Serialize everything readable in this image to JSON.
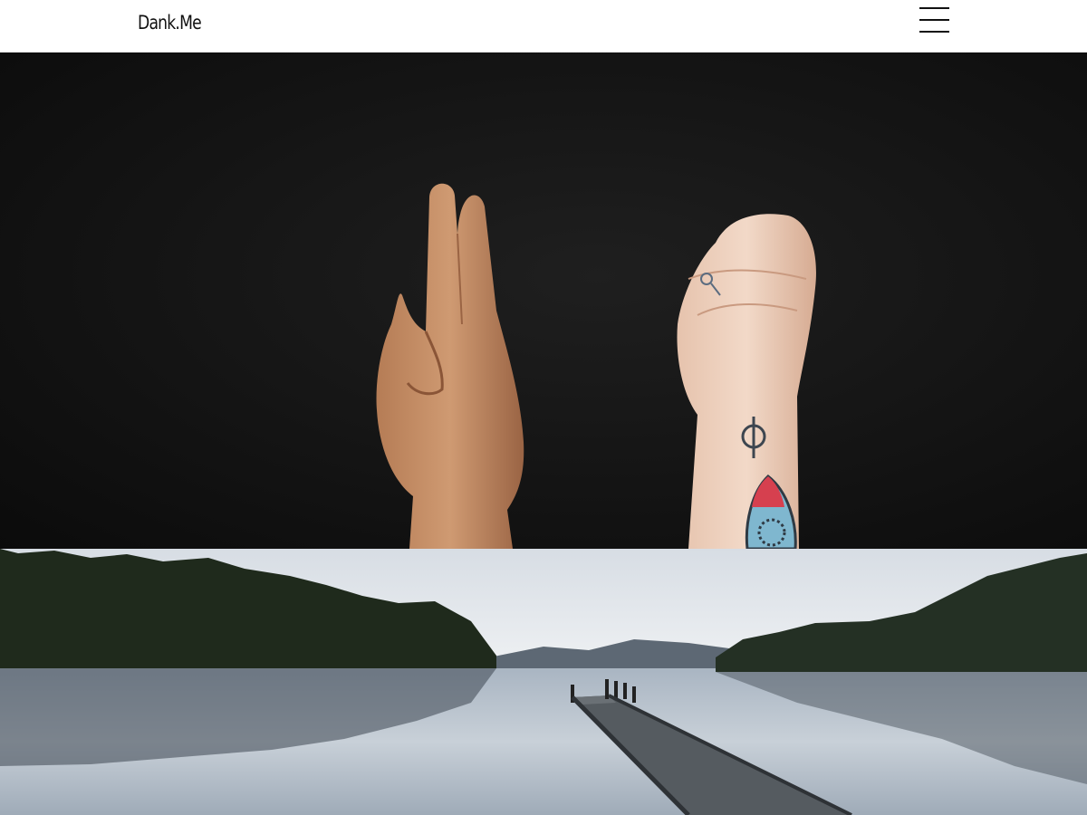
{
  "header": {
    "brand": "Dank.Me",
    "menu_icon": "hamburger-menu-icon"
  },
  "hero": {
    "image": "hands-sign-language-photo"
  },
  "lake": {
    "image": "lake-jetty-photo"
  },
  "colors": {
    "header_bg": "#ffffff",
    "hero_bg": "#141414",
    "sky": "#e6eaef",
    "water": "#b9c4cf",
    "forest": "#1f2a1c"
  }
}
